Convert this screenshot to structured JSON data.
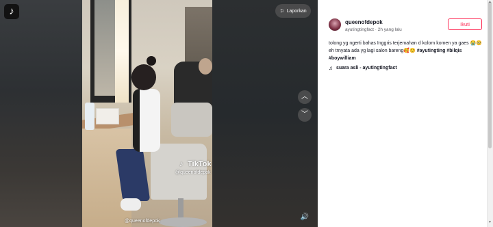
{
  "stage": {
    "report_label": "Laporkan",
    "watermark_brand": "TikTok",
    "watermark_user": "@queenofdepok",
    "watermark_bottom": "@queenofdepok",
    "icons": {
      "logo": "tiktok-logo",
      "report": "flag-icon",
      "prev": "chevron-up-icon",
      "next": "chevron-down-icon",
      "volume": "volume-icon"
    }
  },
  "panel": {
    "username": "queenofdepok",
    "handle": "ayutingtingfact",
    "separator": "·",
    "posted": "2h yang lalu",
    "follow_label": "Ikuti",
    "caption_text": "tolong yg ngerti bahas Inggris terjemahan d kolom komen ya gaes 😭🥺 eh trnyata ada yg lagi salon bareng🥰😊",
    "hashtags": [
      "#ayutingting",
      "#bilqis",
      "#boywilliam"
    ],
    "music": "suara asli - ayutingtingfact",
    "accent_color": "#fe2c55"
  }
}
